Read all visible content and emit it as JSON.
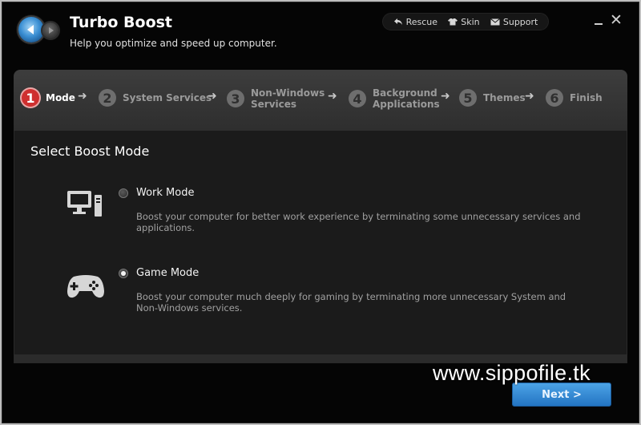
{
  "header": {
    "title": "Turbo Boost",
    "subtitle": "Help you optimize and speed up computer.",
    "links": [
      {
        "label": "Rescue",
        "icon": "undo-arrow-icon"
      },
      {
        "label": "Skin",
        "icon": "shirt-icon"
      },
      {
        "label": "Support",
        "icon": "mail-icon"
      }
    ]
  },
  "steps": [
    {
      "num": "1",
      "label": "Mode",
      "active": true
    },
    {
      "num": "2",
      "label": "System Services"
    },
    {
      "num": "3",
      "label_line1": "Non-Windows",
      "label_line2": "Services"
    },
    {
      "num": "4",
      "label_line1": "Background",
      "label_line2": "Applications"
    },
    {
      "num": "5",
      "label": "Themes"
    },
    {
      "num": "6",
      "label": "Finish"
    }
  ],
  "panel": {
    "title": "Select Boost Mode",
    "modes": [
      {
        "label": "Work Mode",
        "desc_line1": "Boost your computer for better work experience by terminating some unnecessary services and",
        "desc_line2": "applications.",
        "selected": false
      },
      {
        "label": "Game Mode",
        "desc_line1": "Boost your computer much deeply for gaming by terminating more unnecessary System and",
        "desc_line2": "Non-Windows services.",
        "selected": true
      }
    ]
  },
  "footer": {
    "next_label": "Next >",
    "watermark": "www.sippofile.tk"
  },
  "colors": {
    "accent_blue": "#2f86d4",
    "active_step": "#cf2f2f",
    "background": "#050505"
  }
}
